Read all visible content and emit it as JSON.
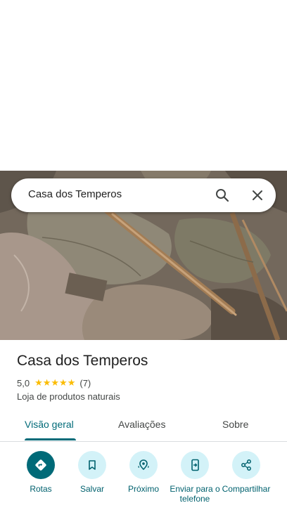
{
  "search": {
    "query": "Casa dos Temperos"
  },
  "place": {
    "name": "Casa dos Temperos",
    "rating": "5,0",
    "stars": "★★★★★",
    "review_count": "(7)",
    "category": "Loja de produtos naturais"
  },
  "tabs": [
    {
      "label": "Visão geral",
      "active": true
    },
    {
      "label": "Avaliações",
      "active": false
    },
    {
      "label": "Sobre",
      "active": false
    }
  ],
  "actions": [
    {
      "label": "Rotas",
      "icon": "directions-icon"
    },
    {
      "label": "Salvar",
      "icon": "bookmark-icon"
    },
    {
      "label": "Próximo",
      "icon": "nearby-icon"
    },
    {
      "label": "Enviar para o telefone",
      "icon": "send-to-phone-icon"
    },
    {
      "label": "Compartilhar",
      "icon": "share-icon"
    }
  ],
  "colors": {
    "accent": "#006a78",
    "chip": "#d3f2f8",
    "star": "#fbbc04"
  }
}
